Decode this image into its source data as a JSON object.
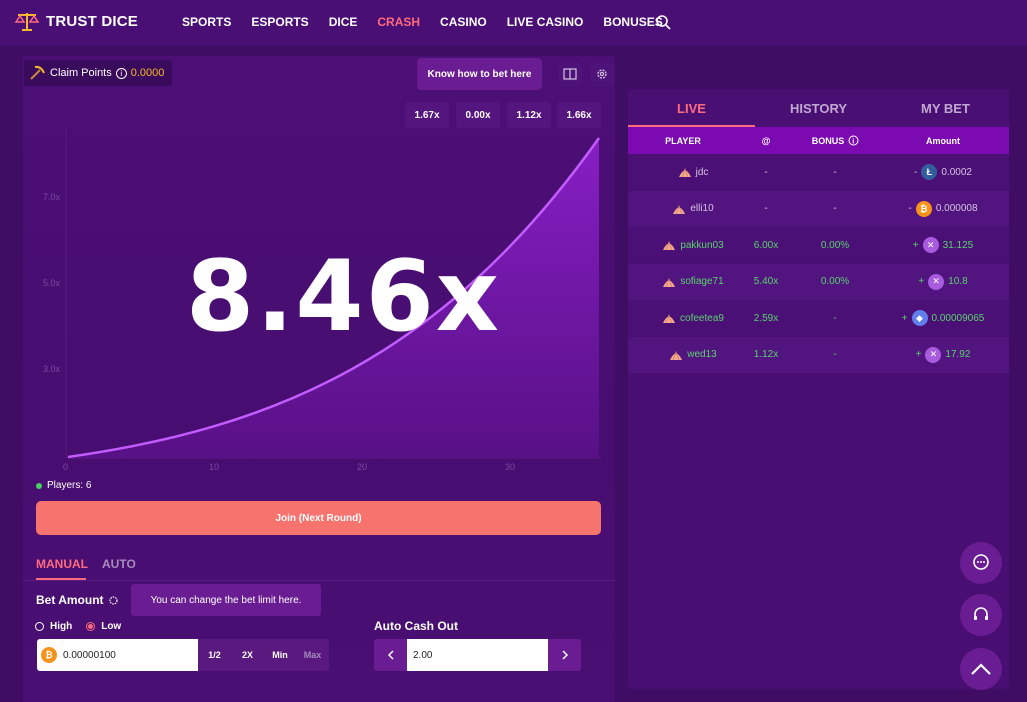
{
  "header": {
    "brand": "TRUST DICE",
    "nav": [
      "SPORTS",
      "ESPORTS",
      "DICE",
      "CRASH",
      "CASINO",
      "LIVE CASINO",
      "BONUSES"
    ],
    "active_nav": "CRASH"
  },
  "game": {
    "claim_label": "Claim Points",
    "claim_value": "0.0000",
    "how_to_bet": "Know how to bet here",
    "history_multipliers": [
      "1.67x",
      "0.00x",
      "1.12x",
      "1.66x"
    ],
    "current_multiplier": "8.46x",
    "chart_y_ticks": [
      "7.0x",
      "5.0x",
      "3.0x"
    ],
    "chart_x_ticks": [
      "0",
      "10",
      "20",
      "30"
    ],
    "players_label": "Players: 6",
    "join_button": "Join (Next Round)",
    "tabs": [
      "MANUAL",
      "AUTO"
    ],
    "bet_amount_label": "Bet Amount",
    "tooltip": "You can change the bet limit here.",
    "radio_high": "High",
    "radio_low": "Low",
    "bet_value": "0.00000100",
    "bet_buttons": [
      "1/2",
      "2X",
      "Min",
      "Max"
    ],
    "auto_cashout_label": "Auto Cash Out",
    "auto_cashout_value": "2.00"
  },
  "bets": {
    "tabs": [
      "LIVE",
      "HISTORY",
      "MY BET"
    ],
    "columns": [
      "PLAYER",
      "@",
      "BONUS",
      "Amount"
    ],
    "rows": [
      {
        "player": "jdc",
        "at": "-",
        "bonus": "-",
        "sign": "-",
        "coin": "ltc",
        "amount": "0.0002",
        "win": false
      },
      {
        "player": "elli10",
        "at": "-",
        "bonus": "-",
        "sign": "-",
        "coin": "btc",
        "amount": "0.000008",
        "win": false
      },
      {
        "player": "pakkun03",
        "at": "6.00x",
        "bonus": "0.00%",
        "sign": "+",
        "coin": "mx",
        "amount": "31.125",
        "win": true
      },
      {
        "player": "sofiage71",
        "at": "5.40x",
        "bonus": "0.00%",
        "sign": "+",
        "coin": "mx",
        "amount": "10.8",
        "win": true
      },
      {
        "player": "cofeetea9",
        "at": "2.59x",
        "bonus": "-",
        "sign": "+",
        "coin": "eth",
        "amount": "0.00009065",
        "win": true
      },
      {
        "player": "wed13",
        "at": "1.12x",
        "bonus": "-",
        "sign": "+",
        "coin": "mx",
        "amount": "17.92",
        "win": true
      }
    ]
  },
  "colors": {
    "accent": "#ff6b7e",
    "bg": "#3f0d63",
    "win": "#59d26e",
    "join": "#f7736d"
  }
}
